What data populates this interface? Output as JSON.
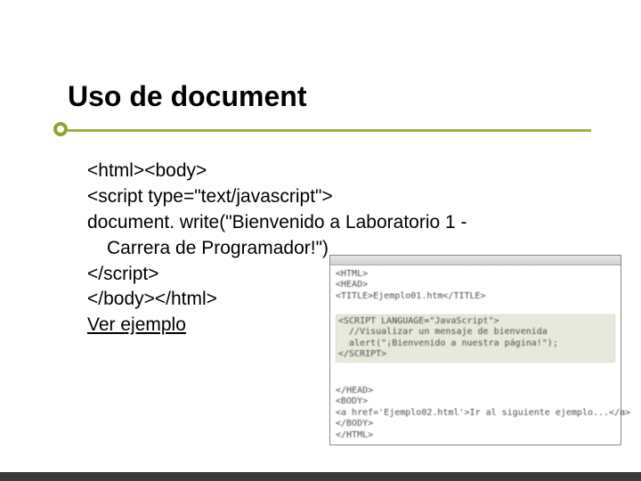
{
  "title": "Uso de document",
  "code": {
    "l1": "<html><body>",
    "l2": "<script type=\"text/javascript\">",
    "l3": "document. write(\"Bienvenido a Laboratorio 1 -",
    "l4": "Carrera de Programador!\")",
    "l5": "</script>",
    "l6": "</body></html>"
  },
  "link_label": "Ver ejemplo",
  "snippet": {
    "a": "<HTML>",
    "b": "<HEAD>",
    "c": "<TITLE>Ejemplo01.htm</TITLE>",
    "d": "<SCRIPT LANGUAGE=\"JavaScript\">",
    "e": "  //Visualizar un mensaje de bienvenida",
    "f": "  alert(\"¡Bienvenido a nuestra página!\");",
    "g": "</SCRIPT>",
    "h": "</HEAD>",
    "i": "<BODY>",
    "j": "<a href='Ejemplo02.html'>Ir al siguiente ejemplo...</a>",
    "k": "</BODY>",
    "l": "</HTML>"
  }
}
